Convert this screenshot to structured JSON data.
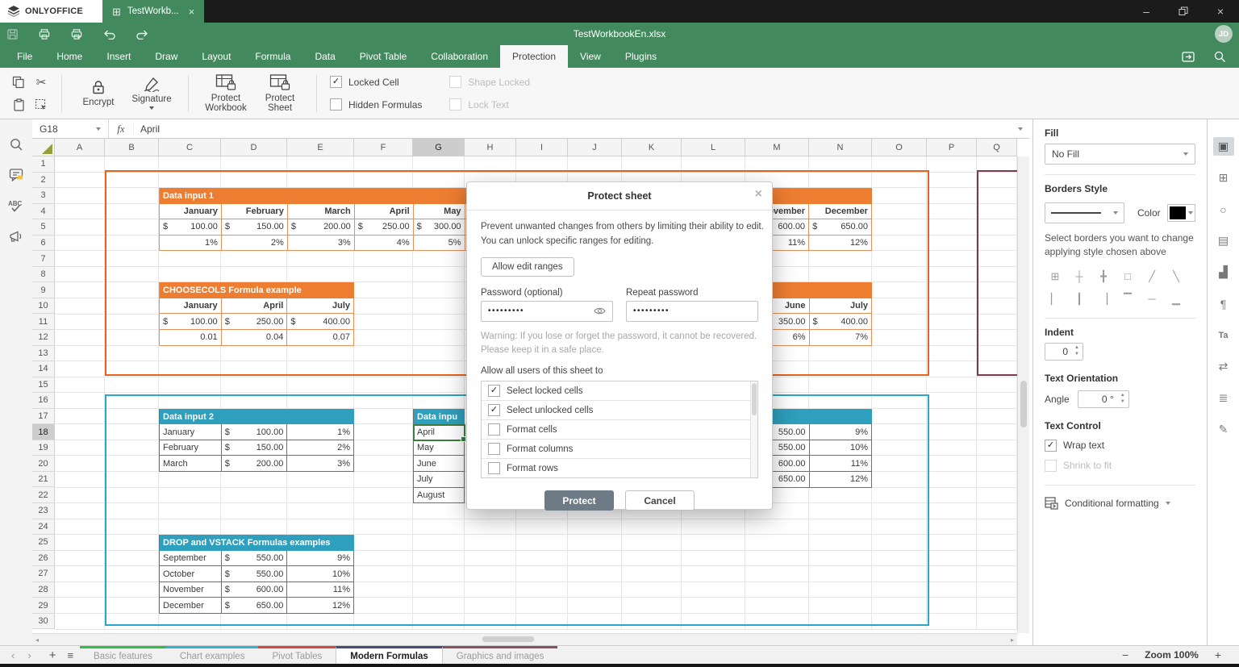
{
  "titlebar": {
    "brand": "ONLYOFFICE",
    "doc_tab_label": "TestWorkb...",
    "filename": "TestWorkbookEn.xlsx",
    "user_initials": "JD"
  },
  "menu": {
    "items": [
      "File",
      "Home",
      "Insert",
      "Draw",
      "Layout",
      "Formula",
      "Data",
      "Pivot Table",
      "Collaboration",
      "Protection",
      "View",
      "Plugins"
    ],
    "active": "Protection"
  },
  "ribbon": {
    "encrypt": "Encrypt",
    "signature": "Signature",
    "protect_workbook": "Protect Workbook",
    "protect_sheet": "Protect Sheet",
    "checkboxes": [
      {
        "label": "Locked Cell",
        "checked": true,
        "disabled": false
      },
      {
        "label": "Hidden Formulas",
        "checked": false,
        "disabled": false
      },
      {
        "label": "Shape Locked",
        "checked": false,
        "disabled": true
      },
      {
        "label": "Lock Text",
        "checked": false,
        "disabled": true
      }
    ]
  },
  "formula_bar": {
    "name_box": "G18",
    "fx": "fx",
    "value": "April"
  },
  "grid": {
    "columns": [
      "A",
      "B",
      "C",
      "D",
      "E",
      "F",
      "G",
      "H",
      "I",
      "J",
      "K",
      "L",
      "M",
      "N",
      "O",
      "P",
      "Q"
    ],
    "selected_column": "G",
    "row_count": 30,
    "selected_row": 18
  },
  "colors": {
    "brand": "#428a5e",
    "orange": "#ed7d31",
    "orange_border": "#e8601c",
    "orange_cell_border": "#e2905c",
    "teal": "#2e9fbd",
    "teal_border": "#2aa7ca",
    "teal_cell_border": "#6f6f6f",
    "maroon_border": "#7b3a4e",
    "selection": "#3c7d45"
  },
  "sheet": {
    "tables": {
      "data_input_1": {
        "title": "Data input 1",
        "theme": "orange",
        "months": [
          "January",
          "February",
          "March",
          "April",
          "May",
          "",
          "",
          "",
          "",
          "",
          "November",
          "December"
        ],
        "values": [
          "$ 100.00",
          "$ 150.00",
          "$ 200.00",
          "$ 250.00",
          "$ 300.00",
          "",
          "",
          "",
          "",
          "",
          "$ 600.00",
          "$ 650.00"
        ],
        "third": [
          "1%",
          "2%",
          "3%",
          "4%",
          "5%",
          "",
          "",
          "",
          "",
          "",
          "11%",
          "12%"
        ]
      },
      "choosecols": {
        "title": "CHOOSECOLS Formula example",
        "theme": "orange",
        "months": [
          "January",
          "April",
          "July"
        ],
        "values": [
          "$ 100.00",
          "$ 250.00",
          "$ 400.00"
        ],
        "third": [
          "0.01",
          "0.04",
          "0.07"
        ]
      },
      "orange_fragment": {
        "title": "",
        "theme": "orange",
        "months": [
          "June",
          "July"
        ],
        "values": [
          "$ 350.00",
          "$ 400.00"
        ],
        "third": [
          "6%",
          "7%"
        ]
      },
      "data_input_2": {
        "title": "Data input 2",
        "theme": "teal",
        "rows": [
          [
            "January",
            "$ 100.00",
            "1%"
          ],
          [
            "February",
            "$ 150.00",
            "2%"
          ],
          [
            "March",
            "$ 200.00",
            "3%"
          ]
        ]
      },
      "data_input_3": {
        "title": "Data inpu",
        "theme": "teal",
        "months": [
          "April",
          "May",
          "June",
          "July",
          "August"
        ],
        "selected": "April"
      },
      "teal_fragment": {
        "title": "",
        "theme": "teal",
        "rows": [
          [
            "$ 550.00",
            "9%"
          ],
          [
            "$ 550.00",
            "10%"
          ],
          [
            "$ 600.00",
            "11%"
          ],
          [
            "$ 650.00",
            "12%"
          ]
        ]
      },
      "drop_vstack": {
        "title": "DROP and VSTACK Formulas examples",
        "theme": "teal",
        "rows": [
          [
            "September",
            "$ 550.00",
            "9%"
          ],
          [
            "October",
            "$ 550.00",
            "10%"
          ],
          [
            "November",
            "$ 600.00",
            "11%"
          ],
          [
            "December",
            "$ 650.00",
            "12%"
          ]
        ]
      }
    }
  },
  "dialog": {
    "title": "Protect sheet",
    "description_line1": "Prevent unwanted changes from others by limiting their ability to edit.",
    "description_line2": "You can unlock specific ranges for editing.",
    "allow_edit_ranges": "Allow edit ranges",
    "password_label": "Password (optional)",
    "repeat_label": "Repeat password",
    "password_value": "•••••••••",
    "repeat_value": "•••••••••",
    "warning_line1": "Warning: If you lose or forget the password, it cannot be recovered.",
    "warning_line2": "Please keep it in a safe place.",
    "allow_label": "Allow all users of this sheet to",
    "options": [
      {
        "label": "Select locked cells",
        "checked": true
      },
      {
        "label": "Select unlocked cells",
        "checked": true
      },
      {
        "label": "Format cells",
        "checked": false
      },
      {
        "label": "Format columns",
        "checked": false
      },
      {
        "label": "Format rows",
        "checked": false
      }
    ],
    "protect_btn": "Protect",
    "cancel_btn": "Cancel"
  },
  "right_panel": {
    "fill_label": "Fill",
    "fill_value": "No Fill",
    "borders_label": "Borders Style",
    "color_label": "Color",
    "borders_hint": "Select borders you want to change applying style chosen above",
    "border_buttons": [
      {
        "name": "all-borders",
        "glyph": "⊞"
      },
      {
        "name": "inner-borders",
        "glyph": "┼"
      },
      {
        "name": "inner-cross",
        "glyph": "╋"
      },
      {
        "name": "outer-borders",
        "glyph": "□"
      },
      {
        "name": "diagonal-up",
        "glyph": "╱"
      },
      {
        "name": "diagonal-down",
        "glyph": "╲"
      },
      {
        "name": "left-border",
        "glyph": "▏"
      },
      {
        "name": "inner-vertical",
        "glyph": "┃"
      },
      {
        "name": "right-border",
        "glyph": "▕"
      },
      {
        "name": "top-border",
        "glyph": "▔"
      },
      {
        "name": "inner-horizontal",
        "glyph": "─"
      },
      {
        "name": "bottom-border",
        "glyph": "▁"
      }
    ],
    "indent_label": "Indent",
    "indent_value": "0",
    "orientation_label": "Text Orientation",
    "angle_label": "Angle",
    "angle_value": "0 °",
    "text_control_label": "Text Control",
    "wrap_text": "Wrap text",
    "shrink": "Shrink to fit",
    "cond_format": "Conditional formatting",
    "strip_icons": [
      {
        "name": "cell-settings-icon",
        "glyph": "▣",
        "active": true
      },
      {
        "name": "table-settings-icon",
        "glyph": "⊞",
        "active": false
      },
      {
        "name": "shape-settings-icon",
        "glyph": "○",
        "active": false
      },
      {
        "name": "image-settings-icon",
        "glyph": "▤",
        "active": false
      },
      {
        "name": "chart-settings-icon",
        "glyph": "▟",
        "active": false
      },
      {
        "name": "paragraph-settings-icon",
        "glyph": "¶",
        "active": false
      },
      {
        "name": "textart-settings-icon",
        "glyph": "Ta",
        "active": false
      },
      {
        "name": "slicer-settings-icon",
        "glyph": "⇄",
        "active": false
      },
      {
        "name": "signature-list-icon",
        "glyph": "≣",
        "active": false
      },
      {
        "name": "signature-settings-icon",
        "glyph": "✎",
        "active": false
      }
    ]
  },
  "sheet_tabs": {
    "items": [
      {
        "label": "Basic features",
        "color": "#2fbe46",
        "active": false
      },
      {
        "label": "Chart examples",
        "color": "#2fb3d4",
        "active": false
      },
      {
        "label": "Pivot Tables",
        "color": "#dc4443",
        "active": false
      },
      {
        "label": "Modern Formulas",
        "color": "#454b7b",
        "active": true
      },
      {
        "label": "Graphics and images",
        "color": "#855064",
        "active": false
      }
    ]
  },
  "status": {
    "zoom": "Zoom 100%"
  }
}
